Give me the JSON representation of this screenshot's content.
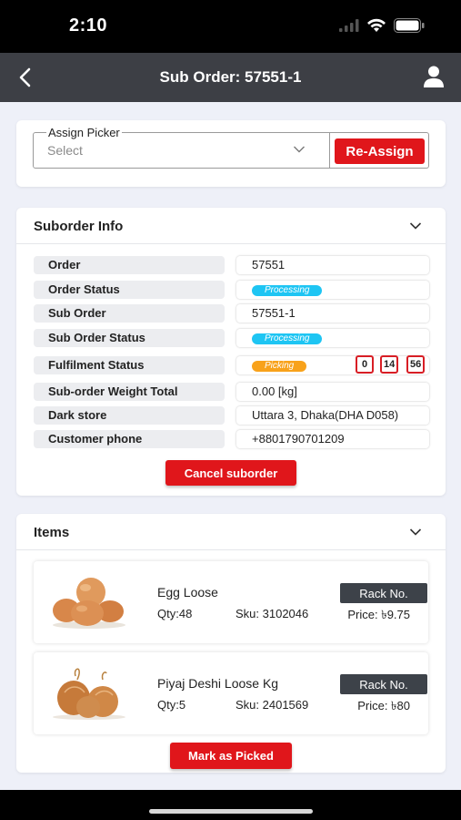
{
  "status_bar": {
    "time": "2:10"
  },
  "header": {
    "title": "Sub Order: 57551-1"
  },
  "assign_picker": {
    "label": "Assign Picker",
    "placeholder": "Select",
    "button_label": "Re-Assign"
  },
  "suborder_info": {
    "title": "Suborder Info",
    "rows": [
      {
        "label": "Order",
        "value": "57551"
      },
      {
        "label": "Order Status",
        "badge": "Processing"
      },
      {
        "label": "Sub Order",
        "value": "57551-1"
      },
      {
        "label": "Sub Order Status",
        "badge": "Processing"
      },
      {
        "label": "Fulfilment Status",
        "badge": "Picking",
        "timer": [
          "0",
          "14",
          "56"
        ]
      },
      {
        "label": "Sub-order Weight Total",
        "value": "0.00 [kg]"
      },
      {
        "label": "Dark store",
        "value": "Uttara 3, Dhaka(DHA D058)"
      },
      {
        "label": "Customer phone",
        "value": "+8801790701209"
      }
    ],
    "cancel_label": "Cancel suborder"
  },
  "items": {
    "title": "Items",
    "list": [
      {
        "name": "Egg Loose",
        "qty": "Qty:48",
        "sku": "Sku: 3102046",
        "price": "Price: ৳9.75",
        "rack_label": "Rack No.",
        "image": "eggs-image"
      },
      {
        "name": "Piyaj Deshi Loose Kg",
        "qty": "Qty:5",
        "sku": "Sku: 2401569",
        "price": "Price: ৳80",
        "rack_label": "Rack No.",
        "image": "onions-image"
      }
    ],
    "mark_label": "Mark as Picked"
  },
  "colors": {
    "accent_red": "#e0161b",
    "header_bg": "#3d3f45",
    "badge_blue": "#1ec5f3",
    "badge_orange": "#f8a21b"
  }
}
